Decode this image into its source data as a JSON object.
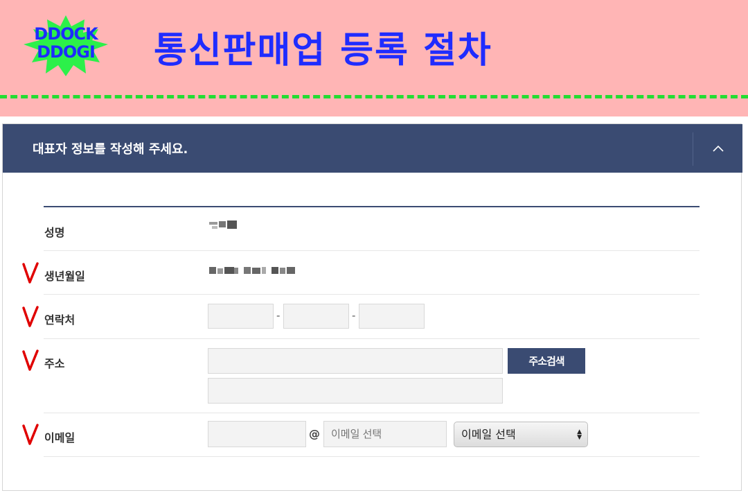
{
  "banner": {
    "logo_line1": "DDOCK",
    "logo_line2": "DDOGI",
    "title": "통신판매업 등록 절차",
    "background_color": "#ffb5b5",
    "dash_color": "#22dd33",
    "title_color": "#1f2cff"
  },
  "panel": {
    "title": "대표자 정보를 작성해 주세요.",
    "header_color": "#3a4b72",
    "collapse_icon": "chevron-up-icon"
  },
  "form": {
    "name_label": "성명",
    "birth_label": "생년월일",
    "phone_label": "연락처",
    "phone_separator": "-",
    "address_label": "주소",
    "address_search_button": "주소검색",
    "email_label": "이메일",
    "email_at": "@",
    "email_domain_placeholder": "이메일 선택",
    "email_select_value": "이메일 선택",
    "required_mark_color": "#e00000"
  }
}
